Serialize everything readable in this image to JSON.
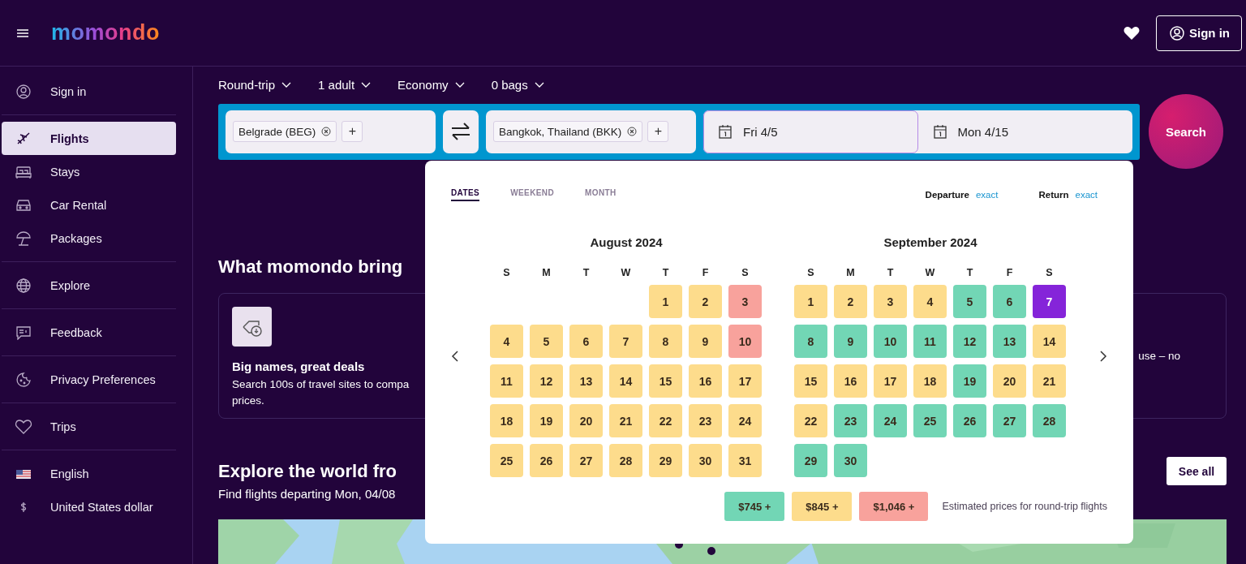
{
  "header": {
    "logo": "momondo",
    "sign_in": "Sign in"
  },
  "sidebar": {
    "items": [
      {
        "label": "Sign in",
        "selected": false,
        "divider_after": true
      },
      {
        "label": "Flights",
        "selected": true,
        "divider_after": false
      },
      {
        "label": "Stays",
        "selected": false,
        "divider_after": false
      },
      {
        "label": "Car Rental",
        "selected": false,
        "divider_after": false
      },
      {
        "label": "Packages",
        "selected": false,
        "divider_after": true
      },
      {
        "label": "Explore",
        "selected": false,
        "divider_after": true
      },
      {
        "label": "Feedback",
        "selected": false,
        "divider_after": true
      },
      {
        "label": "Privacy Preferences",
        "selected": false,
        "divider_after": true
      },
      {
        "label": "Trips",
        "selected": false,
        "divider_after": true
      },
      {
        "label": "English",
        "selected": false,
        "divider_after": false
      },
      {
        "label": "United States dollar",
        "selected": false,
        "divider_after": false
      }
    ]
  },
  "trip_options": [
    "Round-trip",
    "1 adult",
    "Economy",
    "0 bags"
  ],
  "search": {
    "origin": "Belgrade (BEG)",
    "destination": "Bangkok, Thailand (BKK)",
    "add_label": "+",
    "depart": "Fri 4/5",
    "return": "Mon 4/15",
    "button": "Search"
  },
  "date_picker": {
    "tabs": [
      {
        "label": "DATES",
        "selected": true
      },
      {
        "label": "WEEKEND",
        "selected": false
      },
      {
        "label": "MONTH",
        "selected": false
      }
    ],
    "flex": [
      {
        "label": "Departure",
        "value": "exact"
      },
      {
        "label": "Return",
        "value": "exact"
      }
    ],
    "months": [
      {
        "title": "August 2024",
        "weekdays": [
          "S",
          "M",
          "T",
          "W",
          "T",
          "F",
          "S"
        ],
        "days": [
          {
            "kind": "blank"
          },
          {
            "kind": "blank"
          },
          {
            "kind": "blank"
          },
          {
            "kind": "blank"
          },
          {
            "kind": "day",
            "day": "1",
            "color": "#fddc8c",
            "selected": false
          },
          {
            "kind": "day",
            "day": "2",
            "color": "#fddc8c",
            "selected": false
          },
          {
            "kind": "day",
            "day": "3",
            "color": "#f8a29c",
            "selected": false
          },
          {
            "kind": "day",
            "day": "4",
            "color": "#fddc8c",
            "selected": false
          },
          {
            "kind": "day",
            "day": "5",
            "color": "#fddc8c",
            "selected": false
          },
          {
            "kind": "day",
            "day": "6",
            "color": "#fddc8c",
            "selected": false
          },
          {
            "kind": "day",
            "day": "7",
            "color": "#fddc8c",
            "selected": false
          },
          {
            "kind": "day",
            "day": "8",
            "color": "#fddc8c",
            "selected": false
          },
          {
            "kind": "day",
            "day": "9",
            "color": "#fddc8c",
            "selected": false
          },
          {
            "kind": "day",
            "day": "10",
            "color": "#f8a29c",
            "selected": false
          },
          {
            "kind": "day",
            "day": "11",
            "color": "#fddc8c",
            "selected": false
          },
          {
            "kind": "day",
            "day": "12",
            "color": "#fddc8c",
            "selected": false
          },
          {
            "kind": "day",
            "day": "13",
            "color": "#fddc8c",
            "selected": false
          },
          {
            "kind": "day",
            "day": "14",
            "color": "#fddc8c",
            "selected": false
          },
          {
            "kind": "day",
            "day": "15",
            "color": "#fddc8c",
            "selected": false
          },
          {
            "kind": "day",
            "day": "16",
            "color": "#fddc8c",
            "selected": false
          },
          {
            "kind": "day",
            "day": "17",
            "color": "#fddc8c",
            "selected": false
          },
          {
            "kind": "day",
            "day": "18",
            "color": "#fddc8c",
            "selected": false
          },
          {
            "kind": "day",
            "day": "19",
            "color": "#fddc8c",
            "selected": false
          },
          {
            "kind": "day",
            "day": "20",
            "color": "#fddc8c",
            "selected": false
          },
          {
            "kind": "day",
            "day": "21",
            "color": "#fddc8c",
            "selected": false
          },
          {
            "kind": "day",
            "day": "22",
            "color": "#fddc8c",
            "selected": false
          },
          {
            "kind": "day",
            "day": "23",
            "color": "#fddc8c",
            "selected": false
          },
          {
            "kind": "day",
            "day": "24",
            "color": "#fddc8c",
            "selected": false
          },
          {
            "kind": "day",
            "day": "25",
            "color": "#fddc8c",
            "selected": false
          },
          {
            "kind": "day",
            "day": "26",
            "color": "#fddc8c",
            "selected": false
          },
          {
            "kind": "day",
            "day": "27",
            "color": "#fddc8c",
            "selected": false
          },
          {
            "kind": "day",
            "day": "28",
            "color": "#fddc8c",
            "selected": false
          },
          {
            "kind": "day",
            "day": "29",
            "color": "#fddc8c",
            "selected": false
          },
          {
            "kind": "day",
            "day": "30",
            "color": "#fddc8c",
            "selected": false
          },
          {
            "kind": "day",
            "day": "31",
            "color": "#fddc8c",
            "selected": false
          }
        ]
      },
      {
        "title": "September 2024",
        "weekdays": [
          "S",
          "M",
          "T",
          "W",
          "T",
          "F",
          "S"
        ],
        "days": [
          {
            "kind": "day",
            "day": "1",
            "color": "#fddc8c",
            "selected": false
          },
          {
            "kind": "day",
            "day": "2",
            "color": "#fddc8c",
            "selected": false
          },
          {
            "kind": "day",
            "day": "3",
            "color": "#fddc8c",
            "selected": false
          },
          {
            "kind": "day",
            "day": "4",
            "color": "#fddc8c",
            "selected": false
          },
          {
            "kind": "day",
            "day": "5",
            "color": "#72d6b5",
            "selected": false
          },
          {
            "kind": "day",
            "day": "6",
            "color": "#72d6b5",
            "selected": false
          },
          {
            "kind": "day",
            "day": "7",
            "selected": true
          },
          {
            "kind": "day",
            "day": "8",
            "color": "#72d6b5",
            "selected": false
          },
          {
            "kind": "day",
            "day": "9",
            "color": "#72d6b5",
            "selected": false
          },
          {
            "kind": "day",
            "day": "10",
            "color": "#72d6b5",
            "selected": false
          },
          {
            "kind": "day",
            "day": "11",
            "color": "#72d6b5",
            "selected": false
          },
          {
            "kind": "day",
            "day": "12",
            "color": "#72d6b5",
            "selected": false
          },
          {
            "kind": "day",
            "day": "13",
            "color": "#72d6b5",
            "selected": false
          },
          {
            "kind": "day",
            "day": "14",
            "color": "#fddc8c",
            "selected": false
          },
          {
            "kind": "day",
            "day": "15",
            "color": "#fddc8c",
            "selected": false
          },
          {
            "kind": "day",
            "day": "16",
            "color": "#fddc8c",
            "selected": false
          },
          {
            "kind": "day",
            "day": "17",
            "color": "#fddc8c",
            "selected": false
          },
          {
            "kind": "day",
            "day": "18",
            "color": "#fddc8c",
            "selected": false
          },
          {
            "kind": "day",
            "day": "19",
            "color": "#72d6b5",
            "selected": false
          },
          {
            "kind": "day",
            "day": "20",
            "color": "#fddc8c",
            "selected": false
          },
          {
            "kind": "day",
            "day": "21",
            "color": "#fddc8c",
            "selected": false
          },
          {
            "kind": "day",
            "day": "22",
            "color": "#fddc8c",
            "selected": false
          },
          {
            "kind": "day",
            "day": "23",
            "color": "#72d6b5",
            "selected": false
          },
          {
            "kind": "day",
            "day": "24",
            "color": "#72d6b5",
            "selected": false
          },
          {
            "kind": "day",
            "day": "25",
            "color": "#72d6b5",
            "selected": false
          },
          {
            "kind": "day",
            "day": "26",
            "color": "#72d6b5",
            "selected": false
          },
          {
            "kind": "day",
            "day": "27",
            "color": "#72d6b5",
            "selected": false
          },
          {
            "kind": "day",
            "day": "28",
            "color": "#72d6b5",
            "selected": false
          },
          {
            "kind": "day",
            "day": "29",
            "color": "#72d6b5",
            "selected": false
          },
          {
            "kind": "day",
            "day": "30",
            "color": "#72d6b5",
            "selected": false
          }
        ]
      }
    ],
    "legend": [
      {
        "label": "$745 +",
        "color": "#72d6b5"
      },
      {
        "label": "$845 +",
        "color": "#fddc8c"
      },
      {
        "label": "$1,046 +",
        "color": "#f8a29c"
      }
    ],
    "note": "Estimated prices for round-trip flights"
  },
  "features": {
    "heading": "What momondo bring",
    "card": {
      "title": "Big names, great deals",
      "lines": [
        "Search 100s of travel sites to compa",
        "prices."
      ]
    },
    "right_fragment": "use – no"
  },
  "explore": {
    "heading": "Explore the world fro",
    "subtitle": "Find flights departing Mon, 04/08",
    "see_all": "See all"
  }
}
